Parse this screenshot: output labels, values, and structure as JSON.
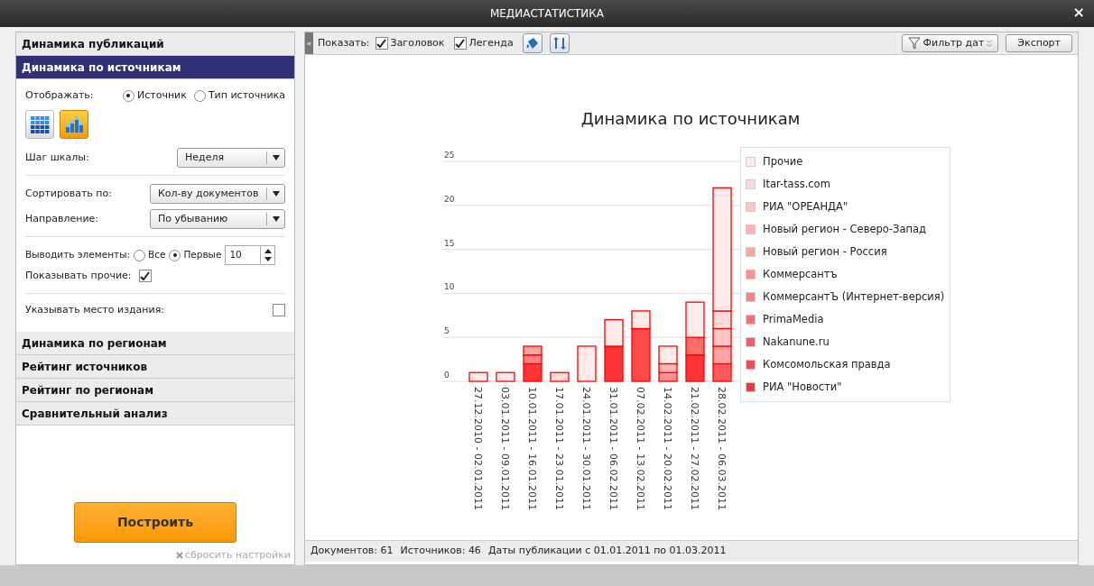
{
  "window": {
    "title": "МЕДИАСТАТИСТИКА",
    "close": "×"
  },
  "left_panel": {
    "sections": [
      {
        "label": "Динамика публикаций",
        "selected": false
      },
      {
        "label": "Динамика по источникам",
        "selected": true
      },
      {
        "label": "Динамика по регионам",
        "selected": false
      },
      {
        "label": "Рейтинг источников",
        "selected": false
      },
      {
        "label": "Рейтинг по регионам",
        "selected": false
      },
      {
        "label": "Сравнительный анализ",
        "selected": false
      }
    ],
    "display": {
      "label": "Отображать:",
      "options": [
        {
          "label": "Источник",
          "selected": true
        },
        {
          "label": "Тип источника",
          "selected": false
        }
      ]
    },
    "view_modes": [
      {
        "kind": "grid",
        "selected": false
      },
      {
        "kind": "chart",
        "selected": true
      }
    ],
    "scale_step": {
      "label": "Шаг шкалы:",
      "value": "Неделя"
    },
    "sort_by": {
      "label": "Сортировать по:",
      "value": "Кол-ву документов"
    },
    "direction": {
      "label": "Направление:",
      "value": "По убыванию"
    },
    "output": {
      "label": "Выводить элементы:",
      "options": [
        {
          "label": "Все",
          "selected": false
        },
        {
          "label": "Первые",
          "selected": true
        }
      ],
      "count": "10"
    },
    "show_other": {
      "label": "Показывать прочие:",
      "checked": true
    },
    "show_place": {
      "label": "Указывать место издания:",
      "checked": false
    },
    "build_button": "Построить",
    "reset_link": "сбросить настройки"
  },
  "toolbar": {
    "collapse": "«",
    "show_label": "Показать:",
    "checkboxes": [
      {
        "label": "Заголовок",
        "checked": true
      },
      {
        "label": "Легенда",
        "checked": true
      }
    ],
    "filter_button": "Фильтр дат",
    "export_button": "Экспорт"
  },
  "chart_data": {
    "type": "bar",
    "stacked": true,
    "grid": true,
    "legend": true,
    "title": "Динамика по источникам",
    "categories": [
      "27.12.2010 - 02.01.2011",
      "03.01.2011 - 09.01.2011",
      "10.01.2011 - 16.01.2011",
      "17.01.2011 - 23.01.2011",
      "24.01.2011 - 30.01.2011",
      "31.01.2011 - 06.02.2011",
      "07.02.2011 - 13.02.2011",
      "14.02.2011 - 20.02.2011",
      "21.02.2011 - 27.02.2011",
      "28.02.2011 - 06.03.2011"
    ],
    "ylim": [
      0,
      25
    ],
    "yticks": [
      0,
      5,
      10,
      15,
      20,
      25
    ],
    "series": [
      {
        "name": "Прочие",
        "color": "#ffeaea",
        "values": [
          1,
          1,
          0,
          0,
          4,
          3,
          2,
          2,
          4,
          14
        ]
      },
      {
        "name": "Itar-tass.com",
        "color": "#ffd8d8",
        "values": [
          0,
          0,
          0,
          1,
          0,
          0,
          0,
          0,
          0,
          2
        ]
      },
      {
        "name": "РИА \"ОРЕАНДА\"",
        "color": "#ffc4c4",
        "values": [
          0,
          0,
          0,
          0,
          0,
          0,
          0,
          0,
          0,
          2
        ]
      },
      {
        "name": "Новый регион - Северо-Запад",
        "color": "#ffb3b3",
        "values": [
          0,
          0,
          0,
          0,
          0,
          0,
          0,
          1,
          0,
          0
        ]
      },
      {
        "name": "Новый регион - Россия",
        "color": "#ffa3a3",
        "values": [
          0,
          0,
          1,
          0,
          0,
          0,
          0,
          0,
          0,
          2
        ]
      },
      {
        "name": "Коммерсантъ",
        "color": "#ff9090",
        "values": [
          0,
          0,
          0,
          0,
          0,
          0,
          0,
          1,
          0,
          0
        ]
      },
      {
        "name": "КоммерсантЪ (Интернет-версия)",
        "color": "#ff8080",
        "values": [
          0,
          0,
          1,
          0,
          0,
          0,
          0,
          0,
          0,
          0
        ]
      },
      {
        "name": "PrimaMedia",
        "color": "#ff6c6c",
        "values": [
          0,
          0,
          0,
          0,
          0,
          0,
          0,
          0,
          2,
          0
        ]
      },
      {
        "name": "Nakanune.ru",
        "color": "#ff5a5a",
        "values": [
          0,
          0,
          0,
          0,
          0,
          0,
          0,
          0,
          0,
          2
        ]
      },
      {
        "name": "Комсомольская правда",
        "color": "#ff4848",
        "values": [
          0,
          0,
          0,
          0,
          0,
          0,
          6,
          0,
          0,
          0
        ]
      },
      {
        "name": "РИА \"Новости\"",
        "color": "#ff3535",
        "values": [
          0,
          0,
          2,
          0,
          0,
          4,
          0,
          0,
          3,
          0
        ]
      }
    ]
  },
  "status_bar": [
    "Документов: 61",
    "Источников: 46",
    "Даты публикации с 01.01.2011 по 01.03.2011"
  ]
}
